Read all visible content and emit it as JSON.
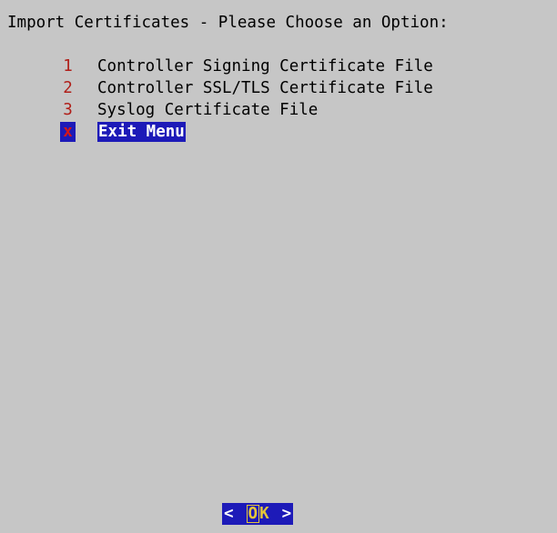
{
  "dialog": {
    "title": "Import Certificates - Please Choose an Option:"
  },
  "menu": {
    "items": [
      {
        "tag": "1",
        "label": "Controller Signing Certificate File",
        "selected": false
      },
      {
        "tag": "2",
        "label": "Controller SSL/TLS Certificate File",
        "selected": false
      },
      {
        "tag": "3",
        "label": "Syslog Certificate File",
        "selected": false
      },
      {
        "tag": "x",
        "label": "Exit Menu",
        "selected": true
      }
    ]
  },
  "buttons": {
    "left_bracket": "<",
    "ok_hotkey": "O",
    "ok_rest": "K",
    "right_bracket": ">"
  },
  "colors": {
    "background": "#c6c6c6",
    "highlight": "#1d1ab8",
    "tag_red": "#b01e18",
    "hotkey_yellow": "#e3c53a"
  }
}
